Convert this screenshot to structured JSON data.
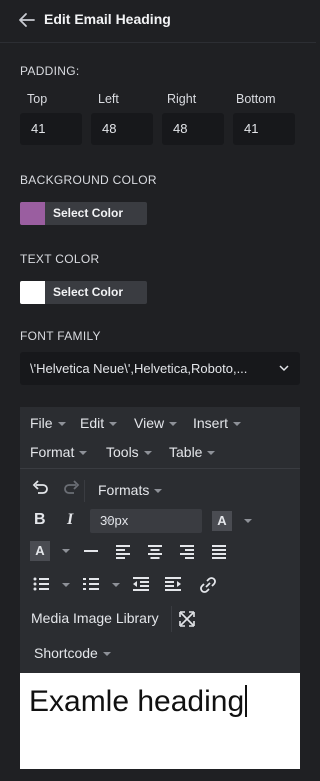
{
  "header": {
    "title": "Edit Email Heading"
  },
  "padding": {
    "label": "PADDING:",
    "fields": [
      {
        "label": "Top",
        "value": "41"
      },
      {
        "label": "Left",
        "value": "48"
      },
      {
        "label": "Right",
        "value": "48"
      },
      {
        "label": "Bottom",
        "value": "41"
      }
    ]
  },
  "background_color": {
    "label": "BACKGROUND COLOR",
    "button": "Select Color",
    "swatch": "#9a5ea0"
  },
  "text_color": {
    "label": "TEXT COLOR",
    "button": "Select Color",
    "swatch": "#ffffff"
  },
  "font_family": {
    "label": "FONT FAMILY",
    "value": "\\'Helvetica Neue\\',Helvetica,Roboto,..."
  },
  "editor": {
    "menus": [
      "File",
      "Edit",
      "View",
      "Insert",
      "Format",
      "Tools",
      "Table"
    ],
    "formats_label": "Formats",
    "font_size": "30px",
    "media_library": "Media Image Library",
    "shortcode": "Shortcode",
    "content": "Examle heading",
    "icons": [
      "undo-icon",
      "redo-icon",
      "bold-icon",
      "italic-icon",
      "text-color-icon",
      "background-color-icon",
      "horizontal-rule-icon",
      "align-left-icon",
      "align-center-icon",
      "align-right-icon",
      "justify-icon",
      "bullet-list-icon",
      "numbered-list-icon",
      "outdent-icon",
      "indent-icon",
      "link-icon",
      "fullscreen-icon"
    ]
  }
}
